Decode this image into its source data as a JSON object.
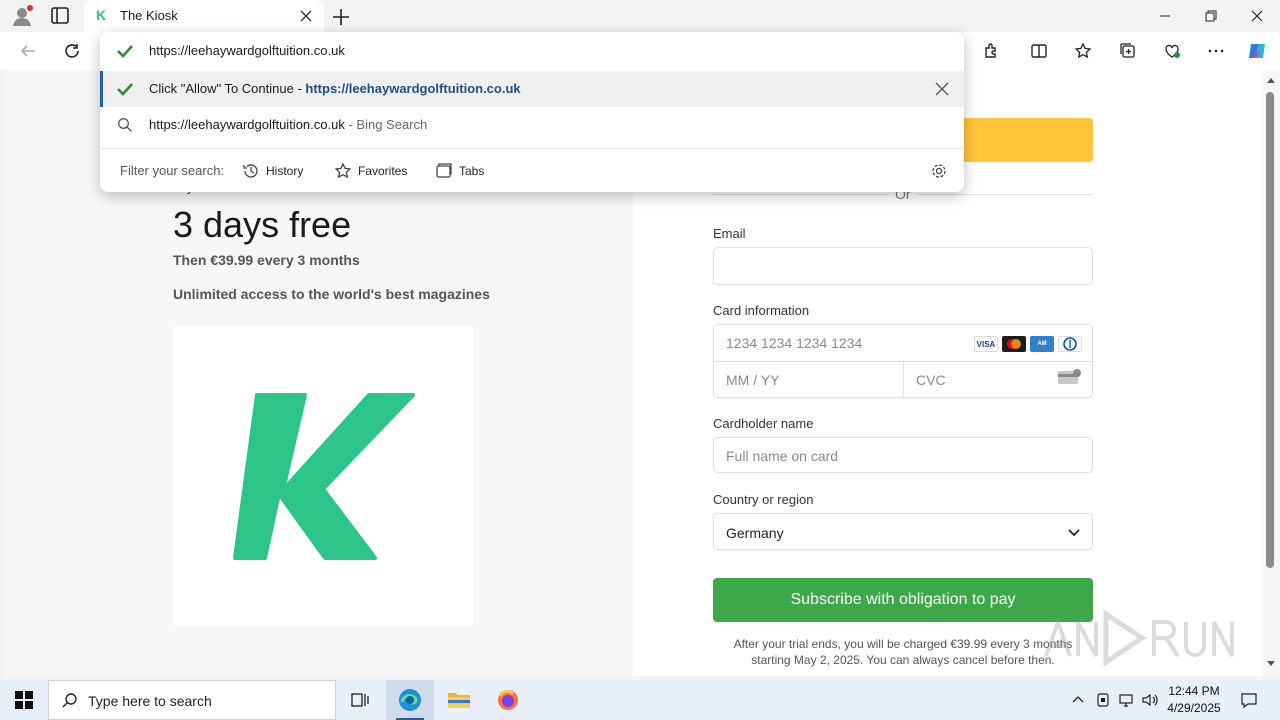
{
  "browser": {
    "tab_title": "The Kiosk",
    "favicon_letter": "K",
    "address_value": "https://leehaywardgolftuition.co.uk"
  },
  "omnibox": {
    "suggestion_1": {
      "prefix": "Click \"Allow\" To Co",
      "middle": "ntinue - ",
      "url": "https://leehaywardgolftuition.co.uk"
    },
    "suggestion_2": {
      "text": "https://leehaywardgolftuition.co.uk",
      "suffix": "- Bing Search"
    },
    "filter_label": "Filter your search:",
    "filters": [
      "History",
      "Favorites",
      "Tabs"
    ]
  },
  "page": {
    "try_label": "Try The Kiosk",
    "headline": "3 days free",
    "price_line": "Then €39.99 every 3 months",
    "tagline": "Unlimited access to the world's best magazines",
    "logo_letter": "K",
    "or_label": "Or",
    "email_label": "Email",
    "card_label": "Card information",
    "card_number_placeholder": "1234 1234 1234 1234",
    "expiry_placeholder": "MM / YY",
    "cvc_placeholder": "CVC",
    "card_brands": [
      "VISA",
      "MC",
      "AMEX",
      "DC"
    ],
    "cardholder_label": "Cardholder name",
    "cardholder_placeholder": "Full name on card",
    "country_label": "Country or region",
    "country_value": "Germany",
    "subscribe_label": "Subscribe with obligation to pay",
    "terms_line1": "After your trial ends, you will be charged €39.99 every 3 months",
    "terms_line2": "starting May 2, 2025. You can always cancel before then."
  },
  "taskbar": {
    "search_placeholder": "Type here to search",
    "time": "12:44 PM",
    "date": "4/29/2025"
  },
  "colors": {
    "brand_green": "#2dc48a",
    "pay_yellow": "#ffc43a",
    "subscribe_green": "#3ca84a",
    "check_green": "#2e8b3a",
    "link_blue": "#1f4f8a"
  }
}
